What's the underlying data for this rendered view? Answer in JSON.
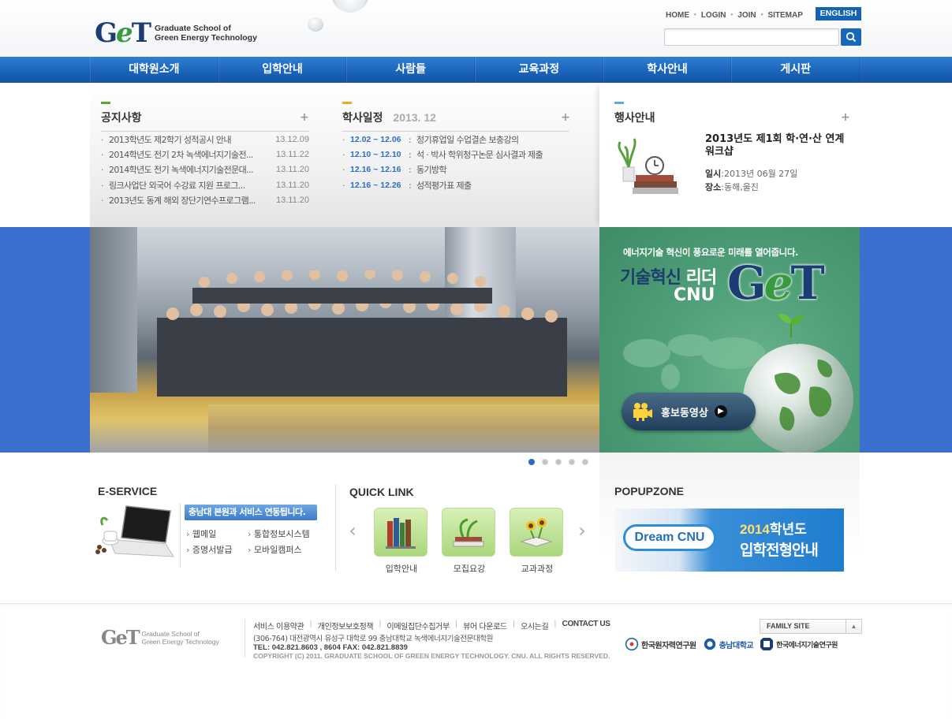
{
  "header": {
    "logo_mark": "GeT",
    "logo_line1": "Graduate School of",
    "logo_line2": "Green Energy Technology",
    "util_links": [
      "HOME",
      "LOGIN",
      "JOIN",
      "SITEMAP"
    ],
    "english_label": "ENGLISH",
    "search_placeholder": ""
  },
  "nav": {
    "items": [
      "대학원소개",
      "입학안내",
      "사람들",
      "교육과정",
      "학사안내",
      "게시판"
    ]
  },
  "notice": {
    "title": "공지사항",
    "items": [
      {
        "text": "2013학년도 제2학기 성적공시 안내",
        "date": "13.12.09"
      },
      {
        "text": "2014학년도 전기 2차 녹색에너지기술전...",
        "date": "13.11.22"
      },
      {
        "text": "2014학년도 전기 녹색에너지기술전문대...",
        "date": "13.11.20"
      },
      {
        "text": "링크사업단 외국어 수강료 지원 프로그...",
        "date": "13.11.20"
      },
      {
        "text": "2013년도 동계 해외 장단기연수프로그램...",
        "date": "13.11.20"
      }
    ]
  },
  "schedule": {
    "title": "학사일정",
    "month": "2013. 12",
    "items": [
      {
        "range": "12.02 ~ 12.06",
        "text": "정기휴업일 수업결손 보충강의"
      },
      {
        "range": "12.10 ~ 12.10",
        "text": "석 · 박사 학위청구논문 심사결과 제출"
      },
      {
        "range": "12.16 ~ 12.16",
        "text": "동기방학"
      },
      {
        "range": "12.16 ~ 12.26",
        "text": "성적평가표 제출"
      }
    ]
  },
  "event": {
    "title": "행사안내",
    "headline": "2013년도 제1회 학·연·산 연계 워크샵",
    "date_label": "일시",
    "date_value": ":2013년 06월 27일",
    "place_label": "장소",
    "place_value": ":동해,울진"
  },
  "promo": {
    "subtitle": "에너지기술 혁신이 풍요로운 미래를 열어줍니다.",
    "line1_a": "기술혁신 ",
    "line1_b": "리더",
    "line2": "CNU",
    "logo": "GeT",
    "video_label": "홍보동영상"
  },
  "slider": {
    "count": 5,
    "active": 0
  },
  "eservice": {
    "title": "E-SERVICE",
    "banner": "충남대 본원과 서비스 연동됩니다.",
    "links": [
      "웹메일",
      "통합정보시스템",
      "증명서발급",
      "모바일캠퍼스"
    ]
  },
  "quicklink": {
    "title": "QUICK LINK",
    "items": [
      "입학안내",
      "모집요강",
      "교과과정"
    ]
  },
  "popupzone": {
    "title": "POPUPZONE",
    "dream": "Dream CNU",
    "year": "2014",
    "year_suffix": "학년도",
    "main": "입학전형안내"
  },
  "footer": {
    "logo_mark": "GeT",
    "logo_line1": "Graduate School of",
    "logo_line2": "Green Energy Technology",
    "links": [
      "서비스 이용약관",
      "개인정보보호정책",
      "이메일집단수집거부",
      "뷰어 다운로드",
      "오시는길",
      "CONTACT US"
    ],
    "address": "(306-764) 대전광역시 유성구 대학로 99  충남대학교 녹색에너지기술전문대학원",
    "tel": "TEL: 042.821.8603 , 8604    FAX: 042.821.8839",
    "copyright": "COPYRIGHT  (C) 2011. GRADUATE SCHOOL OF GREEN ENERGY TECHNOLOGY. CNU.  ALL RIGHTS RESERVED.",
    "family_site": "FAMILY SITE",
    "partners": [
      "한국원자력연구원",
      "충남대학교",
      "한국에너지기술연구원"
    ]
  },
  "colors": {
    "brand_blue": "#1b3d73",
    "nav_blue": "#1a62b9",
    "accent_green": "#3a9a3f",
    "band_blue": "#3c6fd0",
    "date_blue": "#2d6fc0"
  }
}
